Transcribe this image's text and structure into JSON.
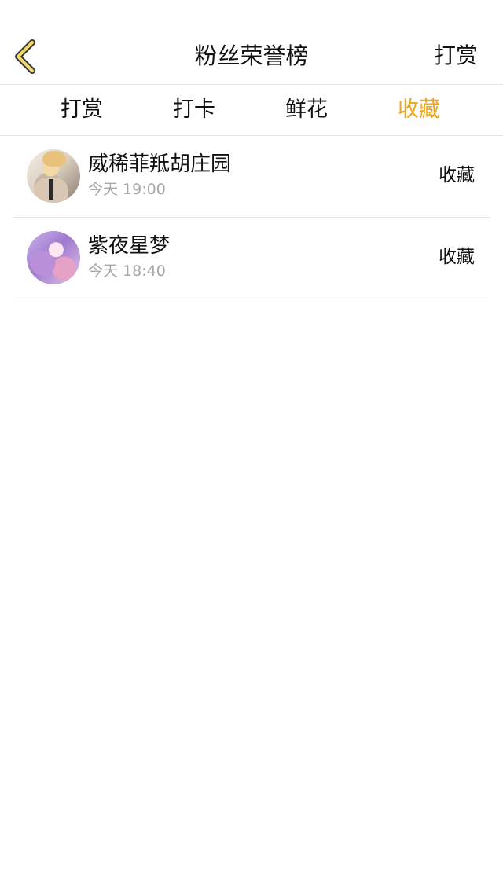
{
  "header": {
    "title": "粉丝荣誉榜",
    "action_label": "打赏",
    "back_icon": "chevron-left-icon",
    "accent_color": "#f0a419"
  },
  "tabs": [
    {
      "label": "打赏",
      "active": false
    },
    {
      "label": "打卡",
      "active": false
    },
    {
      "label": "鲜花",
      "active": false
    },
    {
      "label": "收藏",
      "active": true
    }
  ],
  "list": [
    {
      "name": "威稀菲羝胡庄园",
      "time": "今天 19:00",
      "action": "收藏"
    },
    {
      "name": "紫夜星梦",
      "time": "今天 18:40",
      "action": "收藏"
    }
  ]
}
